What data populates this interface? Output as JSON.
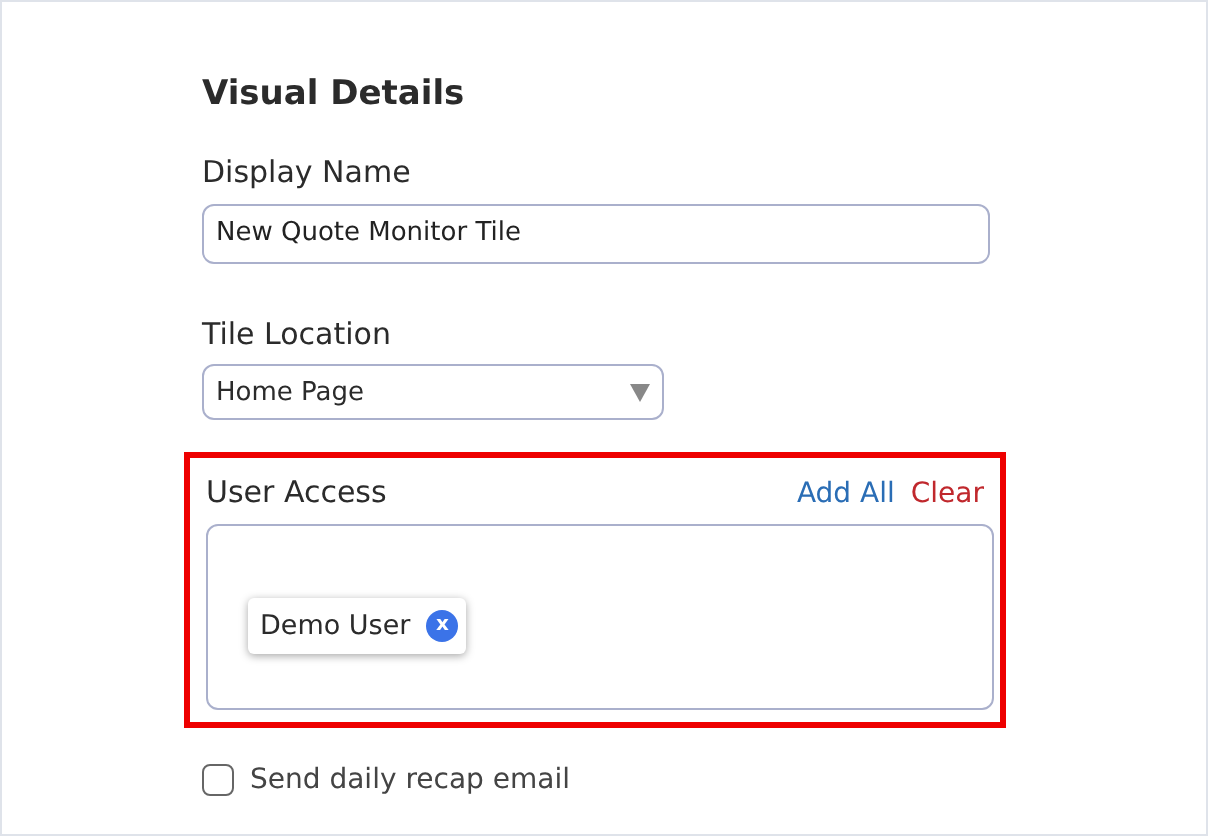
{
  "section_title": "Visual Details",
  "display_name": {
    "label": "Display Name",
    "value": "New Quote Monitor Tile"
  },
  "tile_location": {
    "label": "Tile Location",
    "value": "Home Page"
  },
  "user_access": {
    "label": "User Access",
    "highlighted": true,
    "add_all": "Add All",
    "clear": "Clear",
    "users": [
      {
        "name": "Demo User",
        "remove": "x"
      }
    ]
  },
  "recap_email": {
    "label": "Send daily recap email",
    "checked": false
  }
}
